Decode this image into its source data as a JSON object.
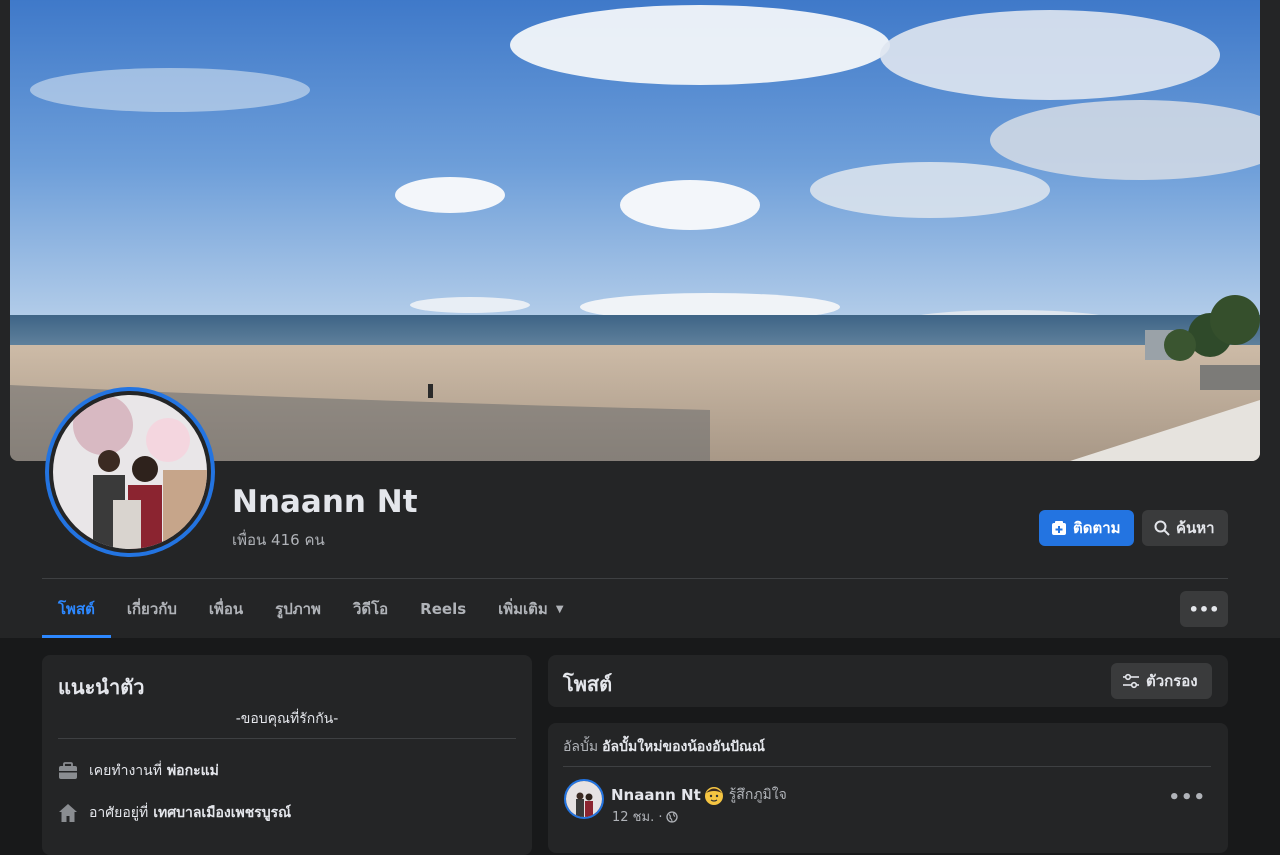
{
  "profile": {
    "name": "Nnaann Nt",
    "friends": "เพื่อน 416 คน"
  },
  "actions": {
    "follow_label": "ติดตาม",
    "search_label": "ค้นหา",
    "more_label": "•••"
  },
  "tabs": [
    {
      "label": "โพสต์",
      "active": true
    },
    {
      "label": "เกี่ยวกับ"
    },
    {
      "label": "เพื่อน"
    },
    {
      "label": "รูปภาพ"
    },
    {
      "label": "วิดีโอ"
    },
    {
      "label": "Reels"
    },
    {
      "label": "เพิ่มเติม"
    }
  ],
  "intro": {
    "title": "แนะนำตัว",
    "bio": "-ขอบคุณที่รักกัน-",
    "work_prefix": "เคยทำงานที่",
    "work_value": "พ่อกะแม่",
    "home_prefix": "อาศัยอยู่ที่",
    "home_value": "เทศบาลเมืองเพชรบูรณ์"
  },
  "posts": {
    "title": "โพสต์",
    "filter_label": "ตัวกรอง"
  },
  "post": {
    "album_prefix": "อัลบั้ม",
    "album_name": "อัลบั้มใหม่ของน้องอันปัณณ์",
    "author": "Nnaann Nt",
    "feeling": "รู้สึกภูมิใจ",
    "time": "12 ชม. ·",
    "more_label": "•••"
  },
  "colors": {
    "accent": "#2374e1",
    "page_bg": "#18191a",
    "card_bg": "#242526",
    "button_bg": "#3a3b3c"
  }
}
